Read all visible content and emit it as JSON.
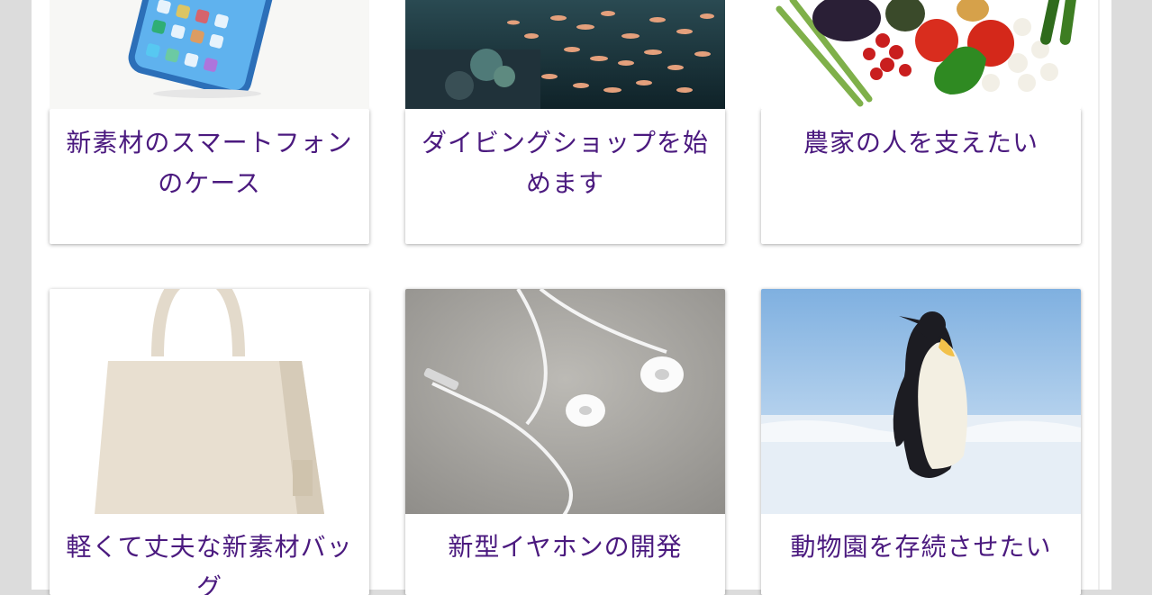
{
  "projects": [
    {
      "title": "新素材のスマートフォンのケース",
      "image": "smartphone-case-photo"
    },
    {
      "title": "ダイビングショップを始めます",
      "image": "underwater-fish-photo"
    },
    {
      "title": "農家の人を支えたい",
      "image": "vegetables-photo"
    },
    {
      "title": "軽くて丈夫な新素材バッグ",
      "image": "canvas-tote-bag-photo"
    },
    {
      "title": "新型イヤホンの開発",
      "image": "earphones-photo"
    },
    {
      "title": "動物園を存続させたい",
      "image": "penguin-photo"
    }
  ]
}
